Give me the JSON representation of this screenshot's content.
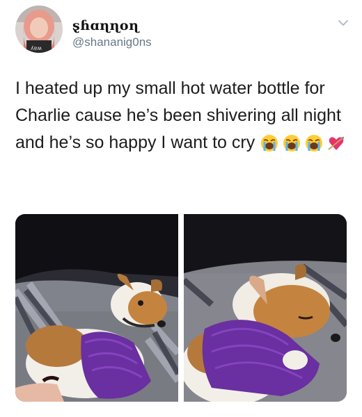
{
  "user": {
    "display_name": "ȿɦɑɳɳoɳ",
    "handle": "@shananig0ns"
  },
  "tweet": {
    "text": "I heated up my small hot water bottle for Charlie cause he’s been shivering all night and he’s so happy I want to cry",
    "emojis": [
      "loudly-crying-face",
      "loudly-crying-face",
      "loudly-crying-face",
      "heart-with-arrow"
    ]
  },
  "media": {
    "photos": [
      {
        "subject": "dog-with-hot-water-bottle"
      },
      {
        "subject": "dog-sleeping-on-hot-water-bottle"
      }
    ]
  },
  "colors": {
    "handle_gray": "#657786",
    "bottle_purple": "#6a2fa0",
    "chevron_gray": "#aab8c2"
  }
}
